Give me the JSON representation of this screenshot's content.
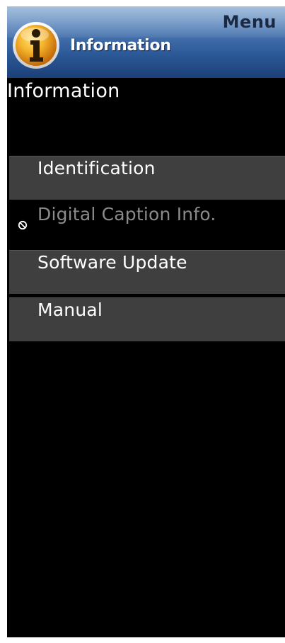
{
  "header": {
    "menu_label": "Menu",
    "title": "Information",
    "icon": "info-icon"
  },
  "page": {
    "title": "Information"
  },
  "menu": {
    "items": [
      {
        "label": "Identification",
        "enabled": true
      },
      {
        "label": "Digital Caption Info.",
        "enabled": false,
        "icon": "disabled-icon"
      },
      {
        "label": "Software Update",
        "enabled": true
      },
      {
        "label": "Manual",
        "enabled": true
      }
    ]
  },
  "colors": {
    "header_blue": "#2d5a99",
    "item_bg": "#3f3f3f",
    "disabled_text": "#8a8a8a",
    "icon_orange": "#f2a01c"
  }
}
